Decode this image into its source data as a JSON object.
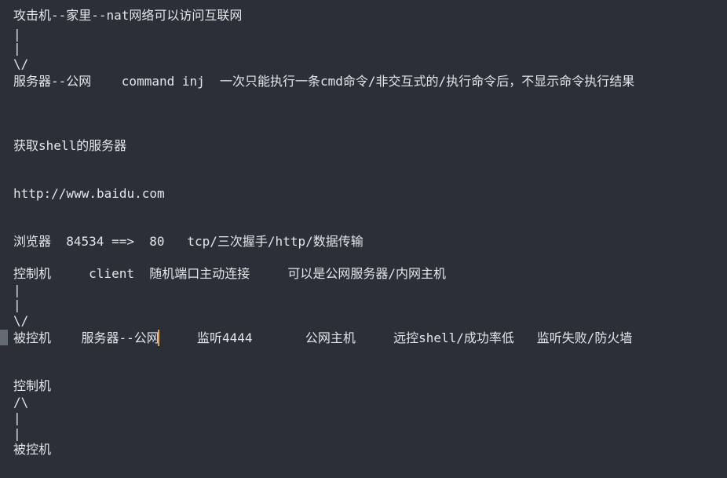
{
  "editor": {
    "lines": [
      "攻击机--家里--nat网络可以访问互联网",
      "|",
      "|",
      "\\/",
      "服务器--公网    command inj  一次只能执行一条cmd命令/非交互式的/执行命令后，不显示命令执行结果",
      "获取shell的服务器",
      "http://www.baidu.com",
      "浏览器  84534 ==>  80   tcp/三次握手/http/数据传输",
      "控制机     client  随机端口主动连接     可以是公网服务器/内网主机",
      "|",
      "|",
      "\\/",
      "被控机    服务器--公网     监听4444       公网主机     远控shell/成功率低   监听失败/防火墙",
      "控制机",
      "/\\",
      "|",
      "|",
      "被控机"
    ]
  }
}
